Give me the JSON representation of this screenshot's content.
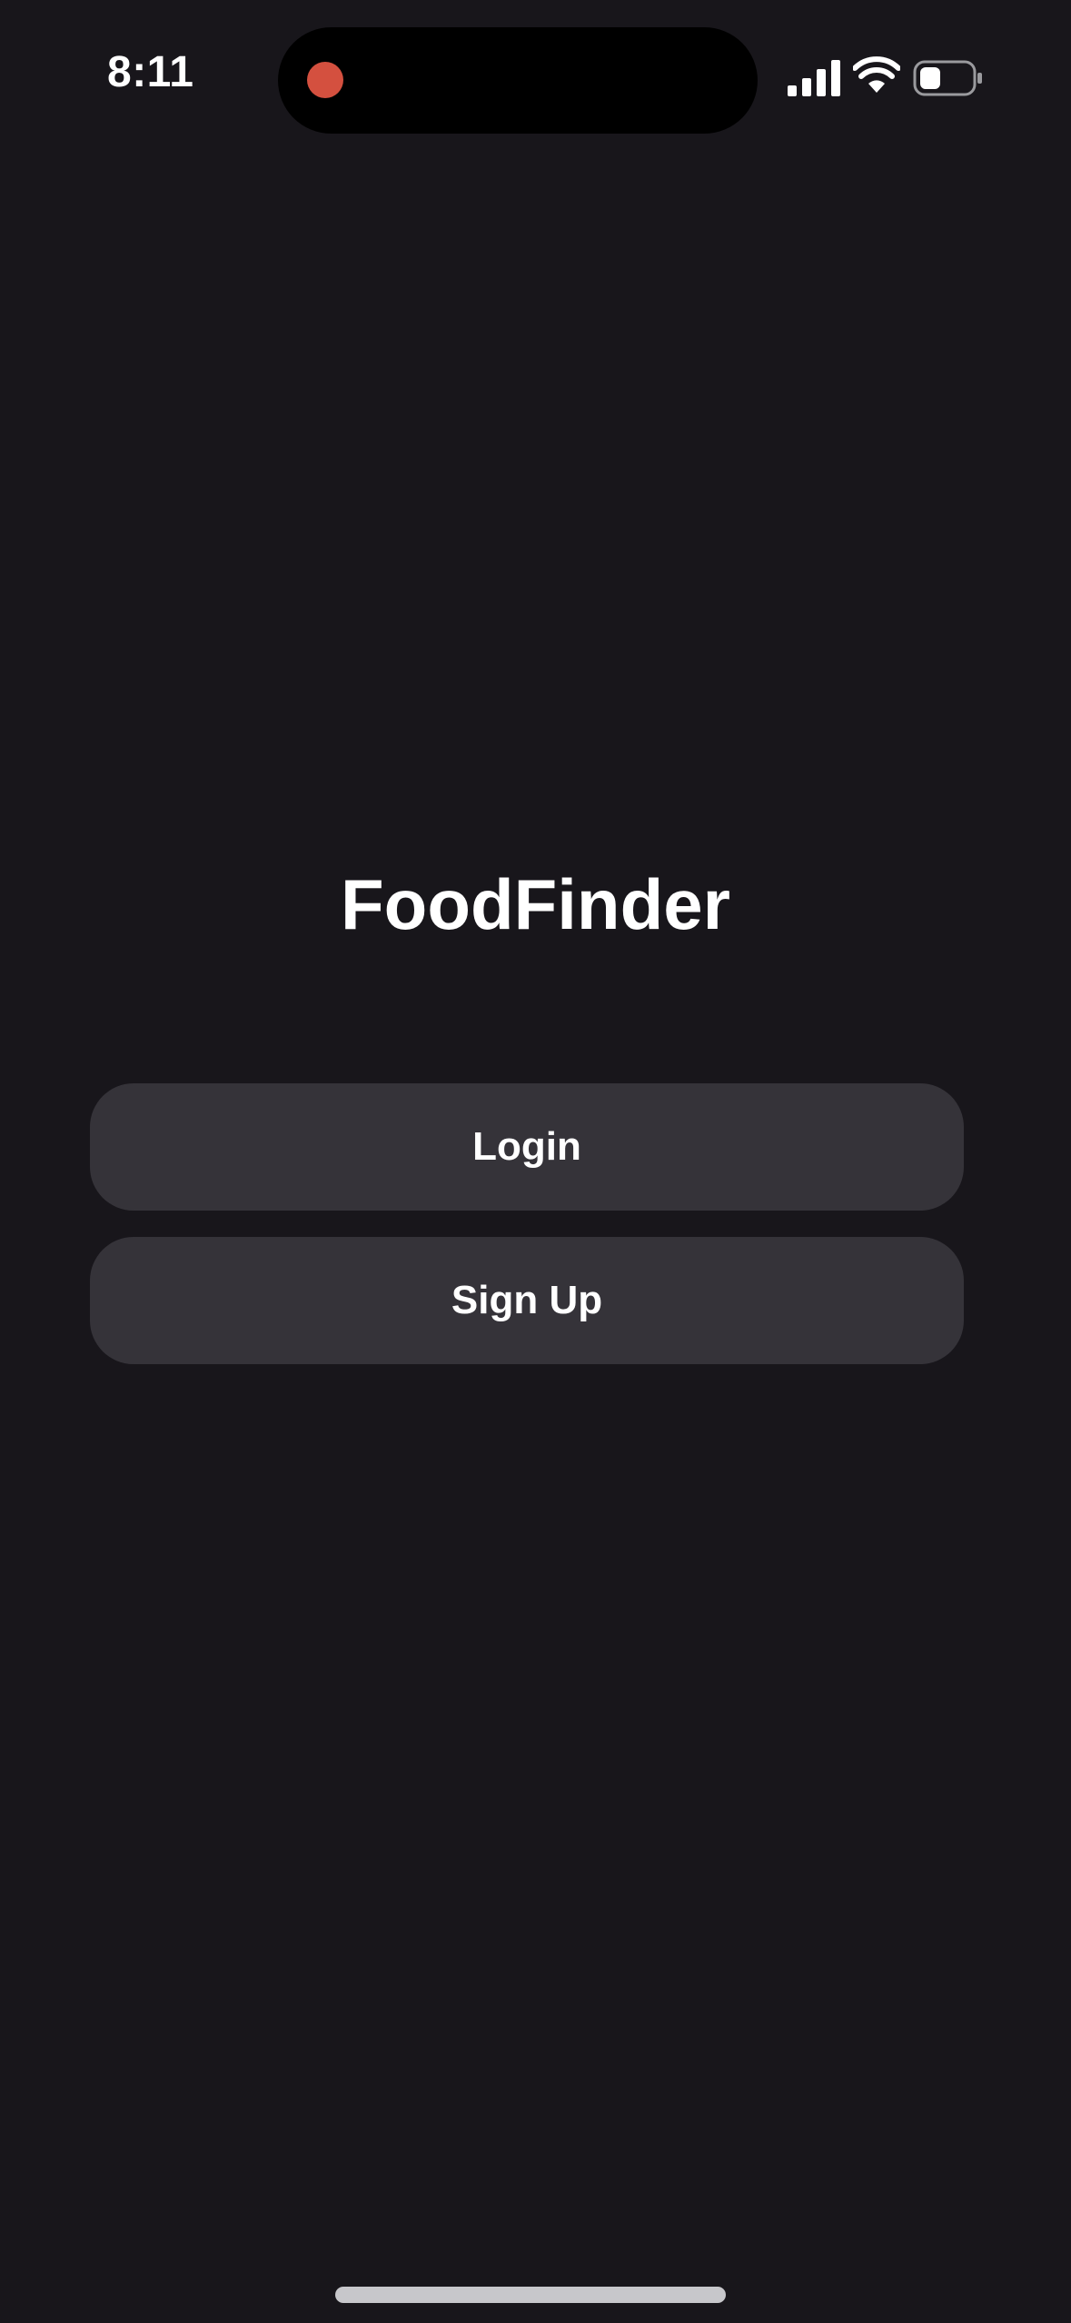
{
  "status_bar": {
    "time": "8:11",
    "icons": [
      "recording-indicator-icon",
      "cellular-signal-icon",
      "wifi-icon",
      "battery-icon"
    ]
  },
  "app": {
    "title": "FoodFinder"
  },
  "buttons": {
    "login_label": "Login",
    "signup_label": "Sign Up"
  },
  "colors": {
    "background": "#18161b",
    "button_background": "#353339",
    "text": "#ffffff",
    "recording_dot": "#d4503f"
  }
}
